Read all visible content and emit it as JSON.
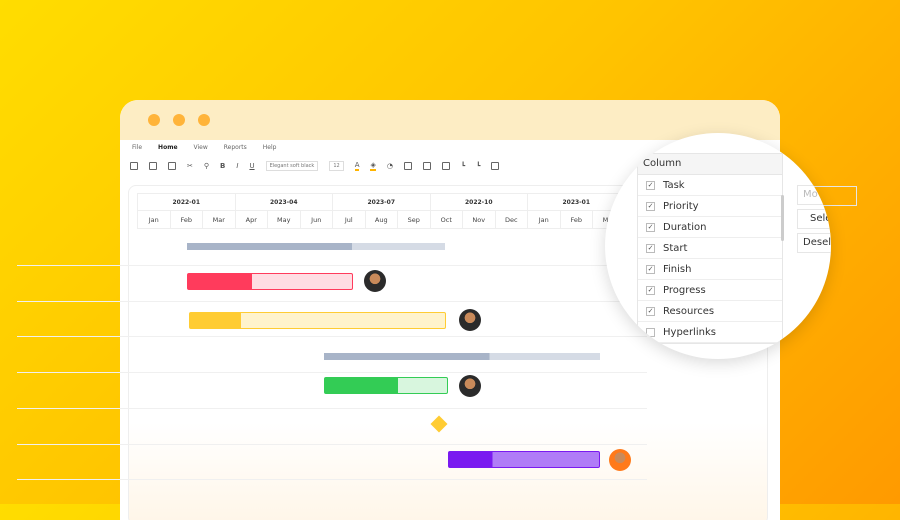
{
  "menu": [
    "File",
    "Home",
    "View",
    "Reports",
    "Help"
  ],
  "toolbar": {
    "font": "Elegant soft black",
    "size": "12",
    "bold": "B",
    "italic": "I",
    "underline": "U",
    "font_color": "A"
  },
  "timeline": {
    "years": [
      "2022-01",
      "2023-04",
      "2023-07",
      "2022-10",
      "2023-01"
    ],
    "months": [
      "Jan",
      "Feb",
      "Mar",
      "Apr",
      "May",
      "Jun",
      "Jul",
      "Aug",
      "Sep",
      "Oct",
      "Nov",
      "Dec",
      "Jan",
      "Feb",
      "Mar"
    ]
  },
  "colors": {
    "red": "#FF3B5C",
    "yellow": "#FFCC33",
    "green": "#33CC55",
    "purple": "#7A1AF0",
    "summary": "#A8B4C8"
  },
  "column_panel": {
    "header": "Column",
    "items": [
      {
        "label": "Task",
        "checked": true
      },
      {
        "label": "Priority",
        "checked": true
      },
      {
        "label": "Duration",
        "checked": true
      },
      {
        "label": "Start",
        "checked": true
      },
      {
        "label": "Finish",
        "checked": true
      },
      {
        "label": "Progress",
        "checked": true
      },
      {
        "label": "Resources",
        "checked": true
      },
      {
        "label": "Hyperlinks",
        "checked": false
      }
    ]
  },
  "side_buttons": [
    "Mo",
    "Sele",
    "Desel"
  ]
}
